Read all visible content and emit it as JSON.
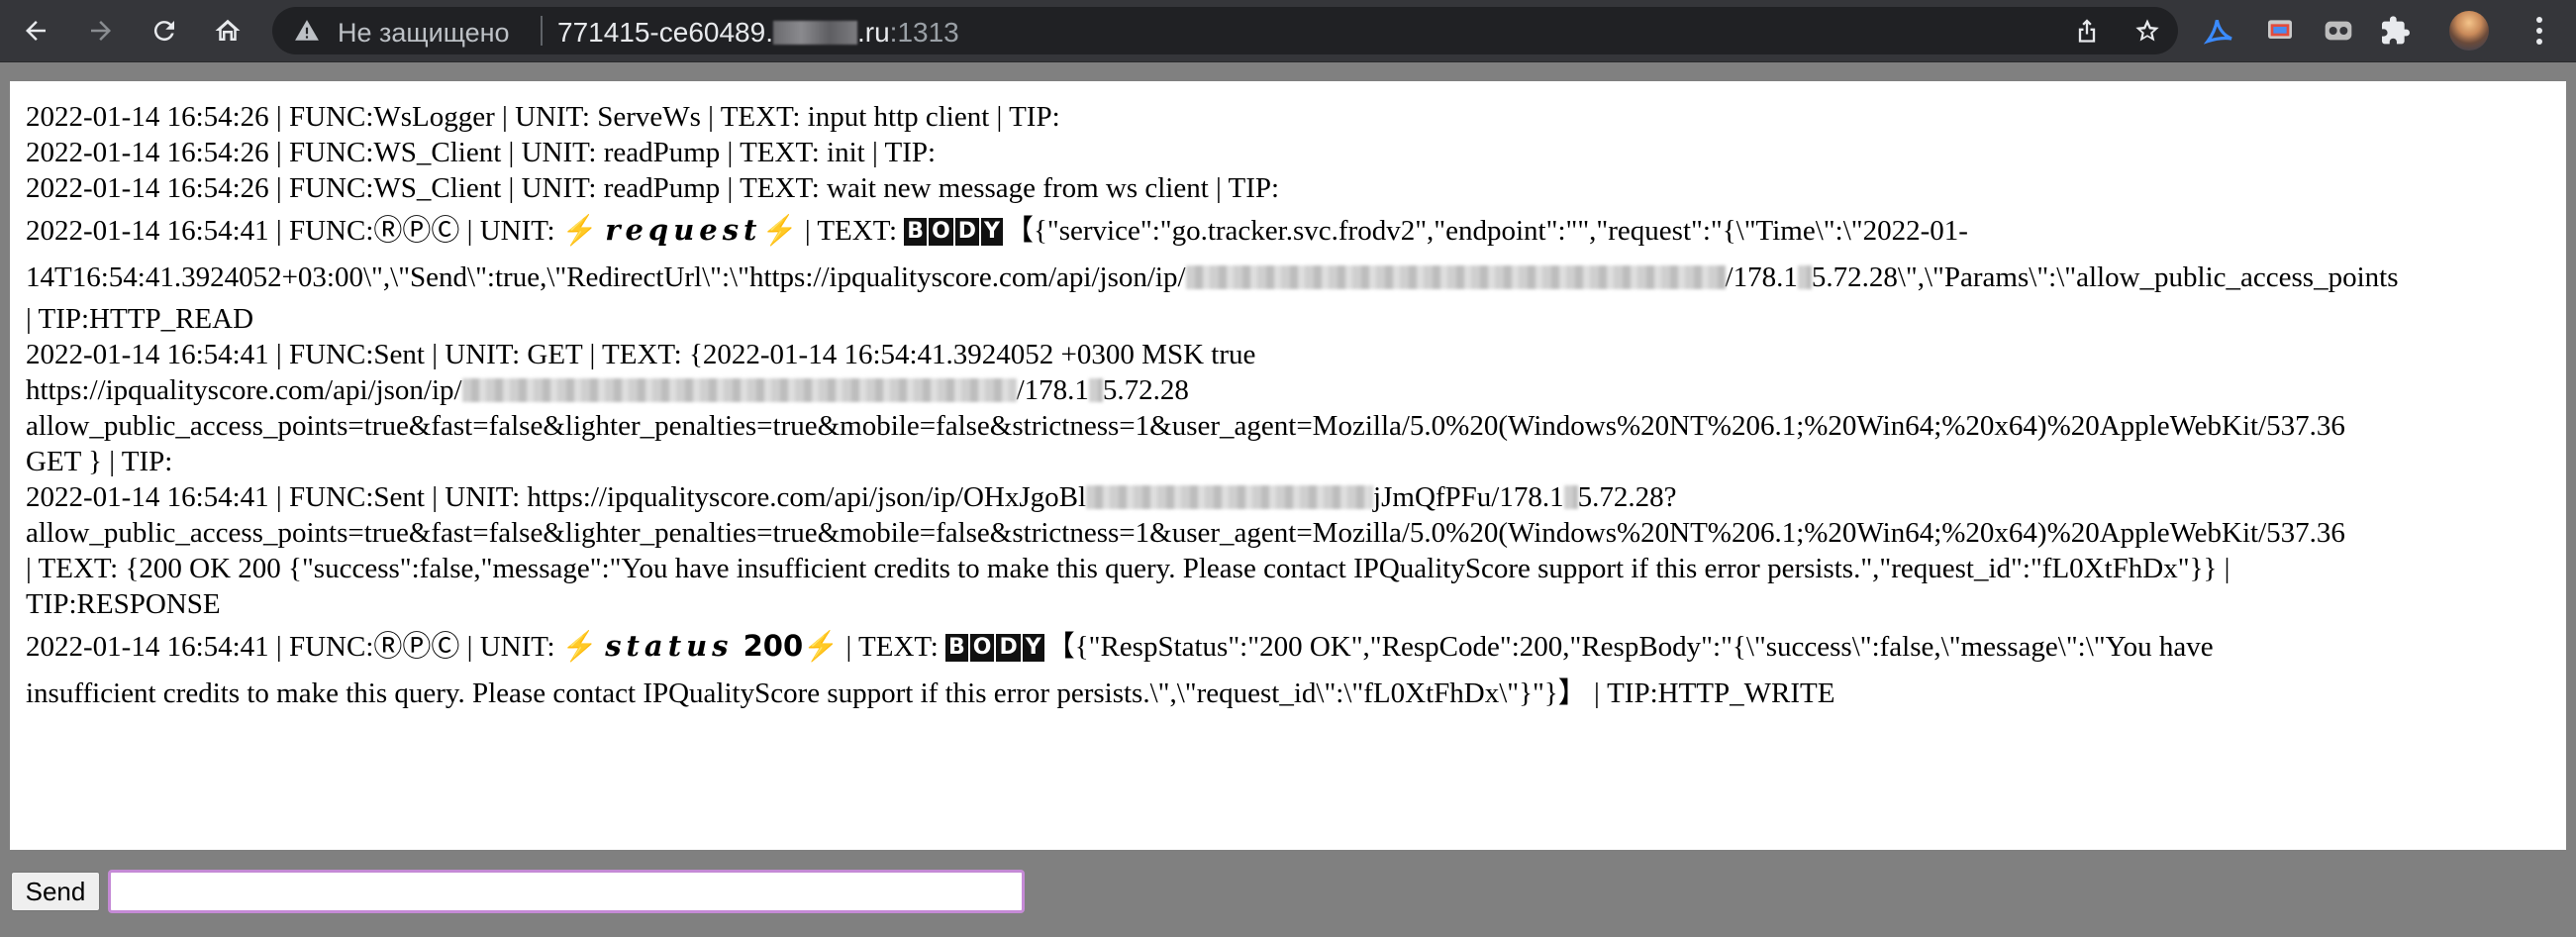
{
  "browser": {
    "security_label": "Не защищено",
    "url_host_prefix": "771415-ce60489.",
    "url_host_suffix": ".ru",
    "url_port": ":1313"
  },
  "log": {
    "lines": [
      "2022-01-14 16:54:26 | FUNC:WsLogger | UNIT: ServeWs | TEXT: input http client | TIP:",
      "2022-01-14 16:54:26 | FUNC:WS_Client | UNIT: readPump | TEXT: init | TIP:",
      "2022-01-14 16:54:26 | FUNC:WS_Client | UNIT: readPump | TEXT: wait new message from ws client | TIP:"
    ],
    "entry4": {
      "prefix": "2022-01-14 16:54:41 | FUNC:ⓇⓅⒸ | UNIT: ",
      "unit_word": "request",
      "mid": " | TEXT: ",
      "body_letters": [
        "B",
        "O",
        "D",
        "Y"
      ],
      "after_body": "【{\"service\":\"go.tracker.svc.frodv2\",\"endpoint\":\"\",\"request\":\"{\\\"Time\\\":\\\"2022-01-",
      "line2_start": "14T16:54:41.3924052+03:00\\\",\\\"Send\\\":true,\\\"RedirectUrl\\\":\\\"https://ipqualityscore.com/api/json/ip/",
      "line2_end": "/178.1",
      "line2_end2": "5.72.28\\\",\\\"Params\\\":\\\"allow_public_access_points",
      "line3": "| TIP:HTTP_READ"
    },
    "entry5": {
      "line1": "2022-01-14 16:54:41 | FUNC:Sent | UNIT: GET | TEXT: {2022-01-14 16:54:41.3924052 +0300 MSK true",
      "line2_start": "https://ipqualityscore.com/api/json/ip/",
      "line2_end": "/178.1",
      "line2_end2": "5.72.28",
      "line3": "allow_public_access_points=true&fast=false&lighter_penalties=true&mobile=false&strictness=1&user_agent=Mozilla/5.0%20(Windows%20NT%206.1;%20Win64;%20x64)%20AppleWebKit/537.36",
      "line4": "GET } | TIP:"
    },
    "entry6": {
      "line1_start": "2022-01-14 16:54:41 | FUNC:Sent | UNIT: https://ipqualityscore.com/api/json/ip/OHxJgoBl",
      "line1_end": "jJmQfPFu/178.1",
      "line1_end2": "5.72.28?",
      "line2": "allow_public_access_points=true&fast=false&lighter_penalties=true&mobile=false&strictness=1&user_agent=Mozilla/5.0%20(Windows%20NT%206.1;%20Win64;%20x64)%20AppleWebKit/537.36",
      "line3": "| TEXT: {200 OK 200 {\"success\":false,\"message\":\"You have insufficient credits to make this query. Please contact IPQualityScore support if this error persists.\",\"request_id\":\"fL0XtFhDx\"}} |",
      "line4": "TIP:RESPONSE"
    },
    "entry7": {
      "prefix": "2022-01-14 16:54:41 | FUNC:ⓇⓅⒸ | UNIT: ",
      "unit_word": "status",
      "unit_num": " 200",
      "mid": " | TEXT: ",
      "body_letters": [
        "B",
        "O",
        "D",
        "Y"
      ],
      "after_body": "【{\"RespStatus\":\"200 OK\",\"RespCode\":200,\"RespBody\":\"{\\\"success\\\":false,\\\"message\\\":\\\"You have",
      "line2": "insufficient credits to make this query. Please contact IPQualityScore support if this error persists.\\\",\\\"request_id\\\":\\\"fL0XtFhDx\\\"}\"}】 | TIP:HTTP_WRITE"
    },
    "bolt": "⚡"
  },
  "form": {
    "send_label": "Send",
    "input_value": ""
  }
}
